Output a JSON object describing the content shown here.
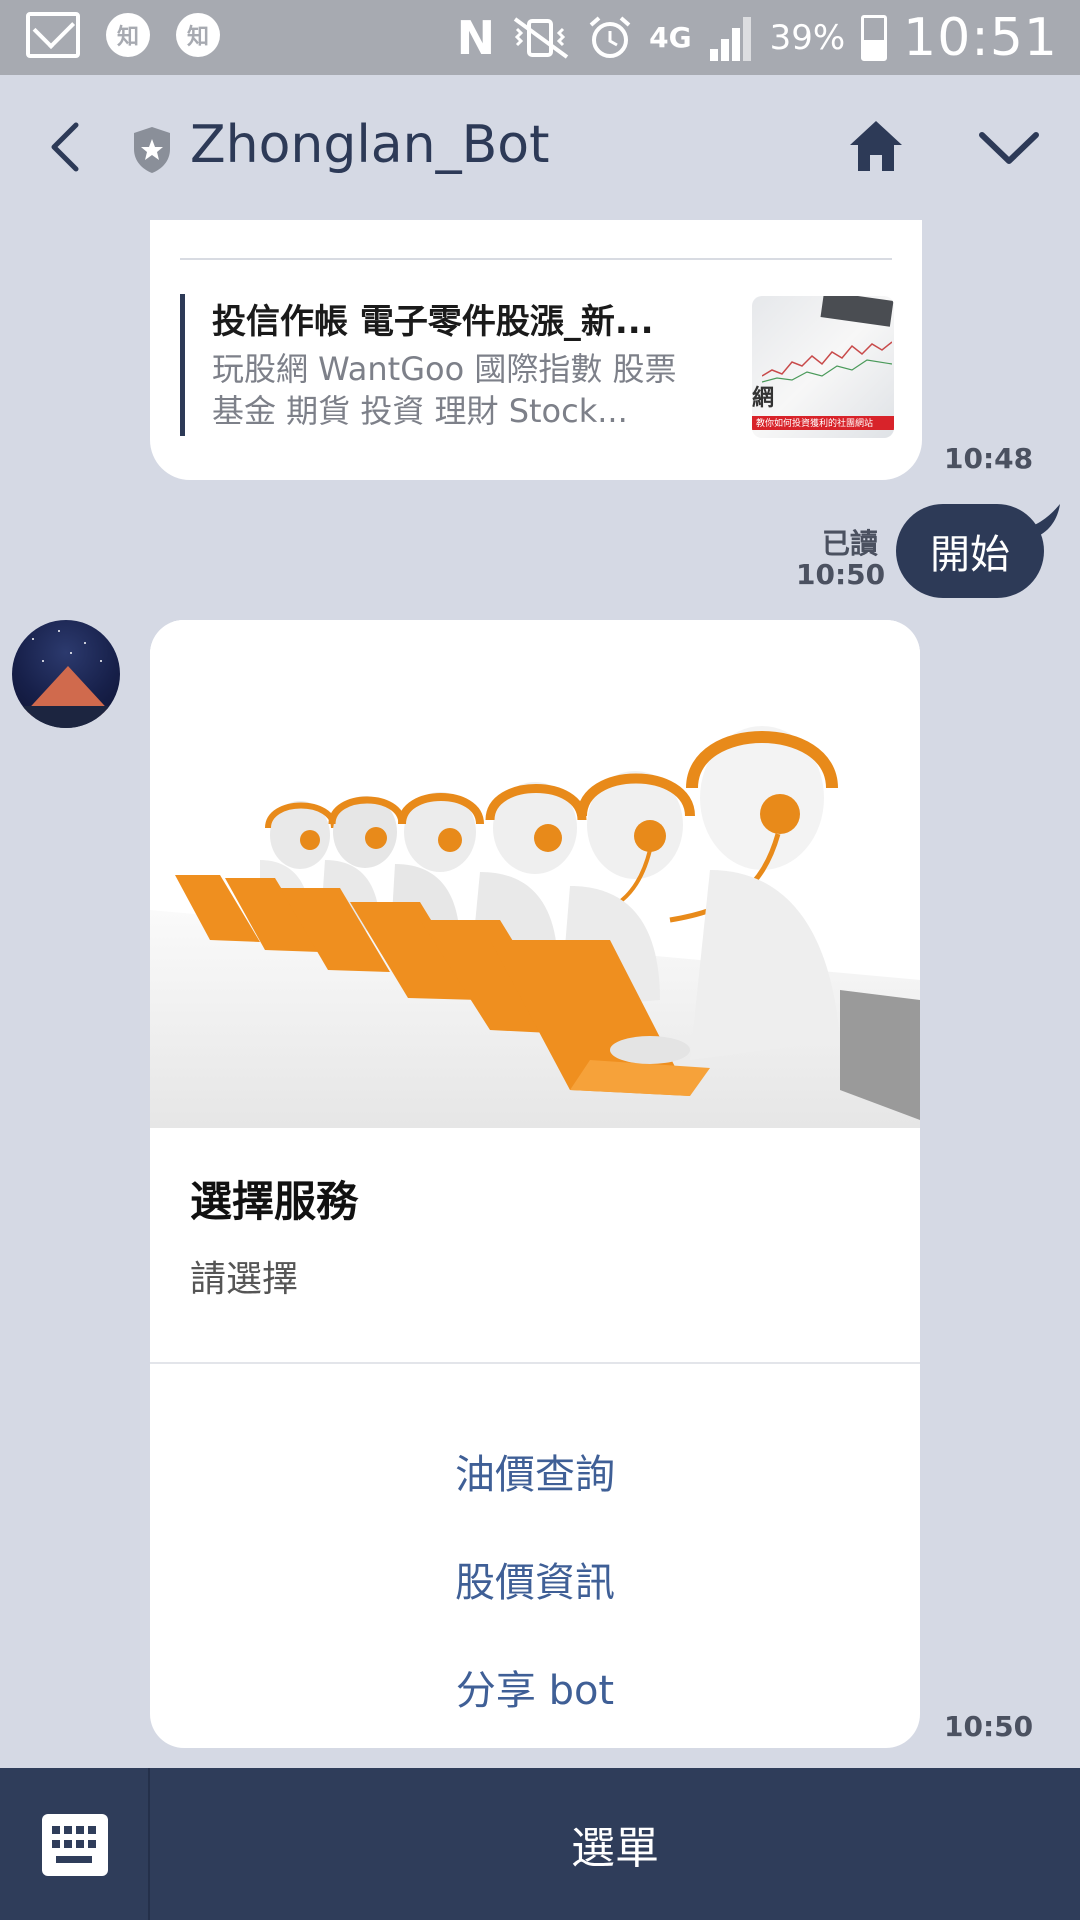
{
  "status_bar": {
    "left_icons": [
      "gmail-icon",
      "zhihu-icon",
      "zhihu-icon"
    ],
    "zhihu_glyph": "知",
    "network": "4G",
    "battery_percent": "39%",
    "battery_level": 0.39,
    "time": "10:51"
  },
  "header": {
    "title": "Zhonglan_Bot"
  },
  "chat": {
    "link_card": {
      "title": "投信作帳 電子零件股漲_新...",
      "description": "玩股網 WantGoo 國際指數 股票 基金 期貨 投資 理財 Stock...",
      "thumb_brand": "網",
      "thumb_tagline": "教你如何投資獲利的社團網站",
      "time": "10:48"
    },
    "user_message": {
      "text": "開始",
      "read_label": "已讀",
      "time": "10:50"
    },
    "template_card": {
      "title": "選擇服務",
      "text": "請選擇",
      "actions": [
        "油價查詢",
        "股價資訊",
        "分享 bot"
      ],
      "time": "10:50"
    }
  },
  "bottom_bar": {
    "menu_label": "選單"
  }
}
